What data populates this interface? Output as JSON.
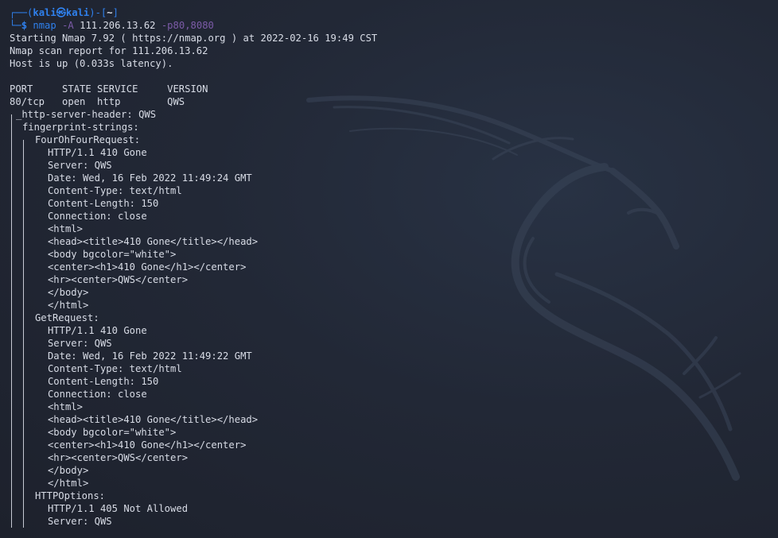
{
  "prompt": {
    "box_open": "┌──(",
    "user": "kali㉿kali",
    "sep": ")-[",
    "cwd": "~",
    "box_close": "]",
    "corner": "└─",
    "dollar": "$",
    "cmd": "nmap",
    "flag": "-A",
    "target": "111.206.13.62",
    "ports": "-p80,8080"
  },
  "colors": {
    "background": "#1f2330",
    "text": "#d8dce6",
    "prompt_blue": "#2f80ed",
    "arg_purple": "#7c5ba8"
  },
  "output": [
    {
      "text": "Starting Nmap 7.92 ( https://nmap.org ) at 2022-02-16 19:49 CST",
      "indent": 0
    },
    {
      "text": "Nmap scan report for 111.206.13.62",
      "indent": 0
    },
    {
      "text": "Host is up (0.033s latency).",
      "indent": 0
    },
    {
      "text": "",
      "indent": 0
    },
    {
      "text": "PORT     STATE SERVICE     VERSION",
      "indent": 0
    },
    {
      "text": "80/tcp   open  http        QWS",
      "indent": 0
    },
    {
      "text": "_http-server-header: QWS",
      "indent": 1
    },
    {
      "text": "fingerprint-strings:",
      "indent": 2
    },
    {
      "text": "FourOhFourRequest:",
      "indent": 4
    },
    {
      "text": "HTTP/1.1 410 Gone",
      "indent": 6
    },
    {
      "text": "Server: QWS",
      "indent": 6
    },
    {
      "text": "Date: Wed, 16 Feb 2022 11:49:24 GMT",
      "indent": 6
    },
    {
      "text": "Content-Type: text/html",
      "indent": 6
    },
    {
      "text": "Content-Length: 150",
      "indent": 6
    },
    {
      "text": "Connection: close",
      "indent": 6
    },
    {
      "text": "<html>",
      "indent": 6
    },
    {
      "text": "<head><title>410 Gone</title></head>",
      "indent": 6
    },
    {
      "text": "<body bgcolor=\"white\">",
      "indent": 6
    },
    {
      "text": "<center><h1>410 Gone</h1></center>",
      "indent": 6
    },
    {
      "text": "<hr><center>QWS</center>",
      "indent": 6
    },
    {
      "text": "</body>",
      "indent": 6
    },
    {
      "text": "</html>",
      "indent": 6
    },
    {
      "text": "GetRequest:",
      "indent": 4
    },
    {
      "text": "HTTP/1.1 410 Gone",
      "indent": 6
    },
    {
      "text": "Server: QWS",
      "indent": 6
    },
    {
      "text": "Date: Wed, 16 Feb 2022 11:49:22 GMT",
      "indent": 6
    },
    {
      "text": "Content-Type: text/html",
      "indent": 6
    },
    {
      "text": "Content-Length: 150",
      "indent": 6
    },
    {
      "text": "Connection: close",
      "indent": 6
    },
    {
      "text": "<html>",
      "indent": 6
    },
    {
      "text": "<head><title>410 Gone</title></head>",
      "indent": 6
    },
    {
      "text": "<body bgcolor=\"white\">",
      "indent": 6
    },
    {
      "text": "<center><h1>410 Gone</h1></center>",
      "indent": 6
    },
    {
      "text": "<hr><center>QWS</center>",
      "indent": 6
    },
    {
      "text": "</body>",
      "indent": 6
    },
    {
      "text": "</html>",
      "indent": 6
    },
    {
      "text": "HTTPOptions:",
      "indent": 4
    },
    {
      "text": "HTTP/1.1 405 Not Allowed",
      "indent": 6
    },
    {
      "text": "Server: QWS",
      "indent": 6
    }
  ]
}
